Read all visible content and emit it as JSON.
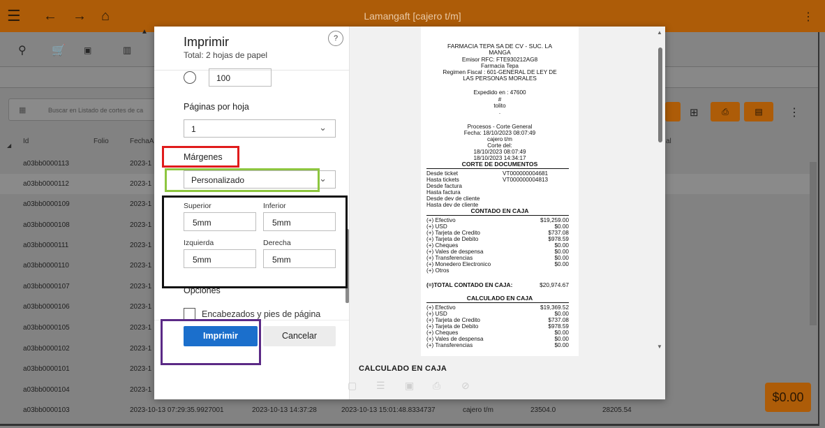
{
  "window": {
    "title": "Lamangaft [cajero t/m]"
  },
  "icons": {
    "menu": "hamburger-icon",
    "back": "arrow-left-icon",
    "forward": "arrow-right-icon",
    "home": "home-icon",
    "more": "more-vertical-icon"
  },
  "background": {
    "search_placeholder": "Buscar en Listado de cortes de ca",
    "headers": {
      "id": "Id",
      "folio": "Folio",
      "fecha": "FechaA",
      "col_l": "al"
    },
    "rows": [
      {
        "id": "a03bb0000113",
        "fecha": "2023-1"
      },
      {
        "id": "a03bb0000112",
        "fecha": "2023-1"
      },
      {
        "id": "a03bb0000109",
        "fecha": "2023-1"
      },
      {
        "id": "a03bb0000108",
        "fecha": "2023-1"
      },
      {
        "id": "a03bb0000111",
        "fecha": "2023-1"
      },
      {
        "id": "a03bb0000110",
        "fecha": "2023-1"
      },
      {
        "id": "a03bb0000107",
        "fecha": "2023-1"
      },
      {
        "id": "a03bb0000106",
        "fecha": "2023-1"
      },
      {
        "id": "a03bb0000105",
        "fecha": "2023-1"
      },
      {
        "id": "a03bb0000102",
        "fecha": "2023-1"
      },
      {
        "id": "a03bb0000101",
        "fecha": "2023-1"
      },
      {
        "id": "a03bb0000104",
        "fecha": "2023-1"
      }
    ],
    "last_row": {
      "id": "a03bb0000103",
      "c1": "2023-10-13 07:29:35.9927001",
      "c2": "2023-10-13 14:37:28",
      "c3": "2023-10-13 15:01:48.8334737",
      "c4": "cajero t/m",
      "c5": "23504.0",
      "c6": "28205.54"
    },
    "amount": "$0.00"
  },
  "dialog": {
    "title": "Imprimir",
    "subtitle": "Total: 2 hojas de papel",
    "help": "?",
    "copies_value": "100",
    "pages_per_sheet_label": "Páginas por hoja",
    "pages_per_sheet_value": "1",
    "margins_label": "Márgenes",
    "margins_value": "Personalizado",
    "superior_label": "Superior",
    "inferior_label": "Inferior",
    "izquierda_label": "Izquierda",
    "derecha_label": "Derecha",
    "superior_value": "5mm",
    "inferior_value": "5mm",
    "izquierda_value": "5mm",
    "derecha_value": "5mm",
    "options_label": "Opciones",
    "headers_footers_label": "Encabezados y pies de página",
    "print_button": "Imprimir",
    "cancel_button": "Cancelar"
  },
  "ticket": {
    "header": [
      "FARMACIA TEPA SA DE CV - SUC. LA",
      "MANGA",
      "Emisor RFC: FTE930212AG8",
      "Farmacia Tepa",
      "Regimen Fiscal : 601-GENERAL DE LEY DE",
      "LAS PERSONAS MORALES"
    ],
    "expedido": [
      "Expedido en : 47600",
      "#",
      "tolito",
      "."
    ],
    "proceso": [
      "Procesos - Corte General",
      "Fecha: 18/10/2023 08:07:49",
      "cajero t/m",
      "Corte del:",
      "18/10/2023 08:07:49",
      "18/10/2023 14:34:17"
    ],
    "corte_title": "CORTE DE DOCUMENTOS",
    "docs": [
      {
        "label": "Desde ticket",
        "value": "VT000000004681"
      },
      {
        "label": "Hasta tickets",
        "value": "VT000000004813"
      },
      {
        "label": "Desde factura",
        "value": ""
      },
      {
        "label": "Hasta factura",
        "value": ""
      },
      {
        "label": "Desde dev de cliente",
        "value": ""
      },
      {
        "label": "Hasta dev de cliente",
        "value": ""
      }
    ],
    "contado_title": "CONTADO EN CAJA",
    "contado": [
      {
        "label": "(+) Efectivo",
        "value": "$19,259.00"
      },
      {
        "label": "(+) USD",
        "value": "$0.00"
      },
      {
        "label": "(+) Tarjeta de Credito",
        "value": "$737.08"
      },
      {
        "label": "(+) Tarjeta de Debito",
        "value": "$978.59"
      },
      {
        "label": "(+) Cheques",
        "value": "$0.00"
      },
      {
        "label": "(+) Vales de despensa",
        "value": "$0.00"
      },
      {
        "label": "(+) Transferencias",
        "value": "$0.00"
      },
      {
        "label": "(+) Monedero Electronico",
        "value": "$0.00"
      },
      {
        "label": "(+) Otros",
        "value": ""
      }
    ],
    "total_label": "(=)TOTAL CONTADO EN CAJA:",
    "total_value": "$20,974.67",
    "calculado_title": "CALCULADO EN CAJA",
    "calculado": [
      {
        "label": "(+) Efectivo",
        "value": "$19,369.52"
      },
      {
        "label": "(+) USD",
        "value": "$0.00"
      },
      {
        "label": "(+) Tarjeta de Credito",
        "value": "$737.08"
      },
      {
        "label": "(+) Tarjeta de Debito",
        "value": "$978.59"
      },
      {
        "label": "(+) Cheques",
        "value": "$0.00"
      },
      {
        "label": "(+) Vales de despensa",
        "value": "$0.00"
      },
      {
        "label": "(+) Transferencias",
        "value": "$0.00"
      }
    ],
    "bottom_title": "CALCULADO EN CAJA"
  },
  "annotations": {
    "margins_box_color": "#e01b1b",
    "select_box_color": "#8dc63f",
    "inputs_box_color": "#111111",
    "print_box_color": "#5b2a86"
  }
}
